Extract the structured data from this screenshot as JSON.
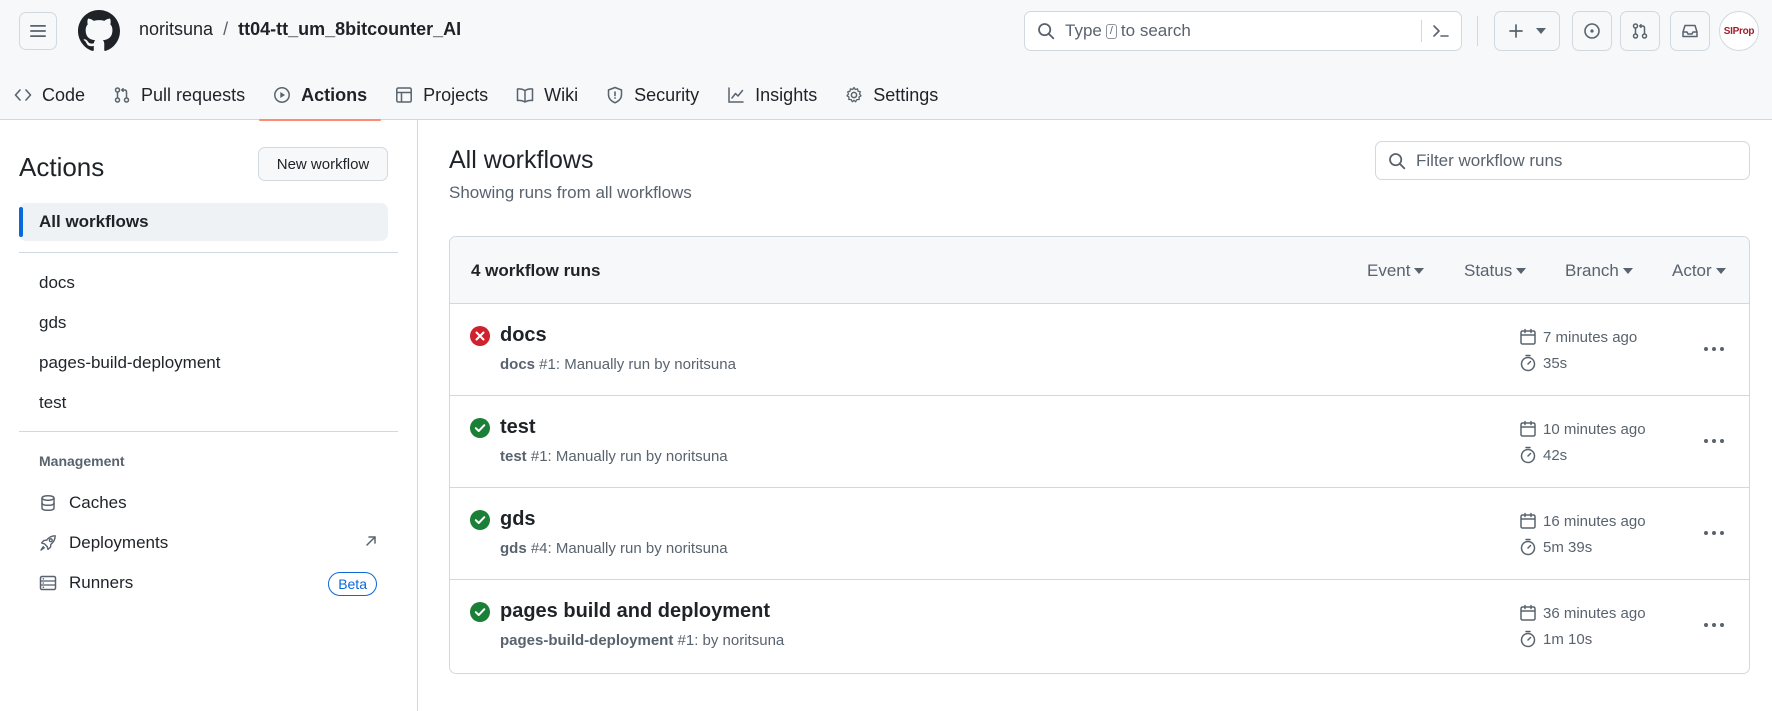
{
  "header": {
    "repo_owner": "noritsuna",
    "repo_separator": "/",
    "repo_name": "tt04-tt_um_8bitcounter_AI",
    "search_prefix": "Type",
    "search_key": "/",
    "search_suffix": "to search",
    "avatar_text": "SIProp"
  },
  "nav": {
    "tabs": [
      {
        "label": "Code",
        "icon": "code-icon"
      },
      {
        "label": "Pull requests",
        "icon": "git-pull-request-icon"
      },
      {
        "label": "Actions",
        "icon": "play-icon",
        "selected": true
      },
      {
        "label": "Projects",
        "icon": "table-icon"
      },
      {
        "label": "Wiki",
        "icon": "book-icon"
      },
      {
        "label": "Security",
        "icon": "shield-icon"
      },
      {
        "label": "Insights",
        "icon": "graph-icon"
      },
      {
        "label": "Settings",
        "icon": "gear-icon"
      }
    ]
  },
  "sidebar": {
    "title": "Actions",
    "new_workflow": "New workflow",
    "all_workflows": "All workflows",
    "workflows": [
      "docs",
      "gds",
      "pages-build-deployment",
      "test"
    ],
    "management_label": "Management",
    "management": [
      {
        "label": "Caches",
        "icon": "database-icon"
      },
      {
        "label": "Deployments",
        "icon": "rocket-icon"
      },
      {
        "label": "Runners",
        "icon": "server-icon",
        "badge": "Beta"
      }
    ]
  },
  "main": {
    "title": "All workflows",
    "subtitle": "Showing runs from all workflows",
    "filter_placeholder": "Filter workflow runs",
    "runs_count": "4 workflow runs",
    "filters": [
      "Event",
      "Status",
      "Branch",
      "Actor"
    ],
    "runs": [
      {
        "name": "docs",
        "meta_bold": "docs",
        "meta_rest": " #1: Manually run by noritsuna",
        "time": "7 minutes ago",
        "duration": "35s",
        "status": "failure"
      },
      {
        "name": "test",
        "meta_bold": "test",
        "meta_rest": " #1: Manually run by noritsuna",
        "time": "10 minutes ago",
        "duration": "42s",
        "status": "success"
      },
      {
        "name": "gds",
        "meta_bold": "gds",
        "meta_rest": " #4: Manually run by noritsuna",
        "time": "16 minutes ago",
        "duration": "5m 39s",
        "status": "success"
      },
      {
        "name": "pages build and deployment",
        "meta_bold": "pages-build-deployment",
        "meta_rest": " #1: by noritsuna",
        "time": "36 minutes ago",
        "duration": "1m 10s",
        "status": "success"
      }
    ]
  },
  "colors": {
    "accent_blue": "#0969da",
    "success_green": "#1a7f37",
    "failure_red": "#cf222e",
    "tab_underline": "#fd8c73"
  }
}
